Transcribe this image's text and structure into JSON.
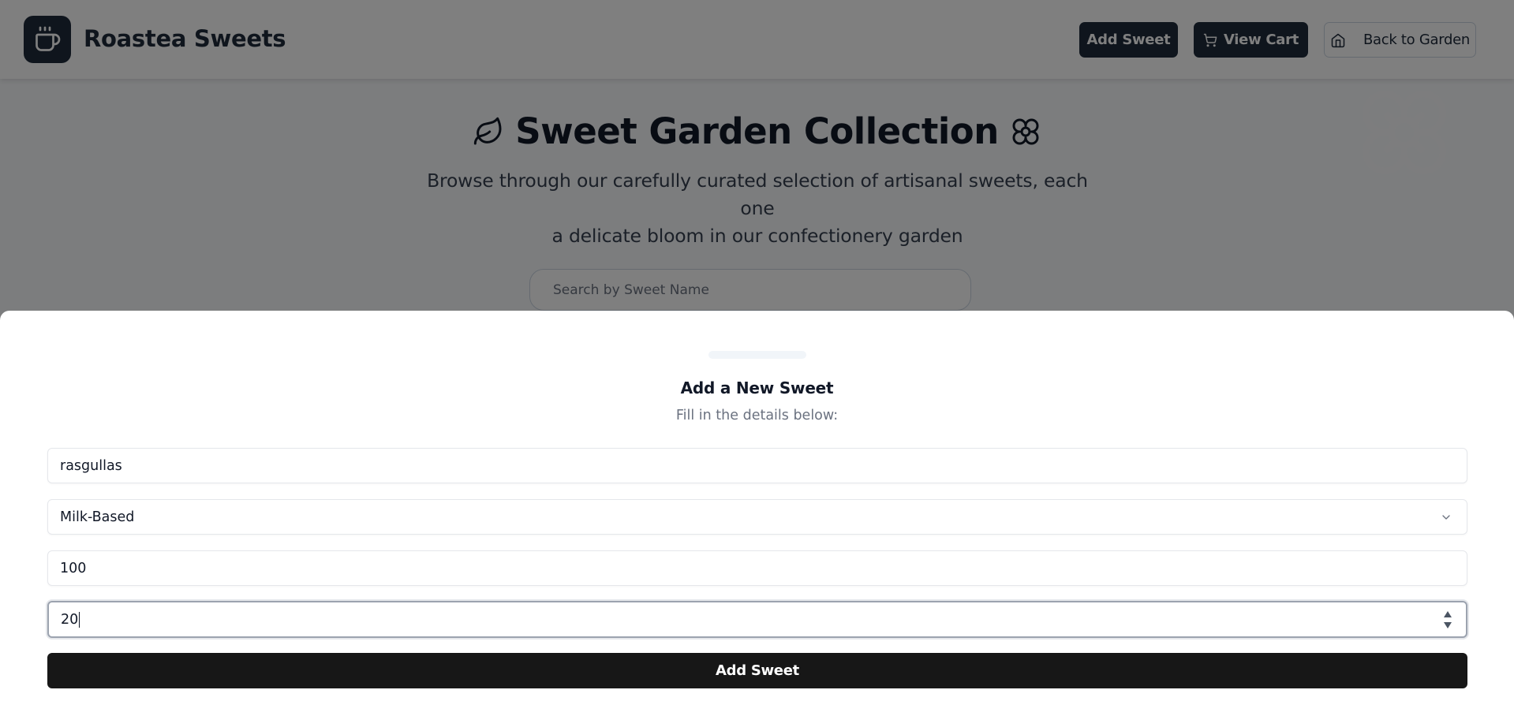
{
  "header": {
    "brand": "Roastea Sweets",
    "add_sweet_label": "Add Sweet",
    "view_cart_label": "View Cart",
    "back_label": "Back to Garden"
  },
  "hero": {
    "title": "Sweet Garden Collection",
    "subtitle_line1": "Browse through our carefully curated selection of artisanal sweets, each one",
    "subtitle_line2": "a delicate bloom in our confectionery garden"
  },
  "search": {
    "placeholder": "Search by Sweet Name"
  },
  "drawer": {
    "title": "Add a New Sweet",
    "description": "Fill in the details below:",
    "name_value": "rasgullas",
    "category_value": "Milk-Based",
    "price_value": "100",
    "quantity_value": "20",
    "submit_label": "Add Sweet"
  },
  "icons": {
    "logo": "coffee-cup-icon",
    "cart": "cart-icon",
    "home": "home-icon",
    "leaf": "leaf-icon",
    "flower": "flower-icon",
    "chevron": "chevron-down-icon",
    "spinner": "number-spinner-icon"
  },
  "colors": {
    "brand_dark": "#1e2a3b",
    "submit_bg": "#171717",
    "overlay": "rgba(0,0,0,0.5)"
  }
}
